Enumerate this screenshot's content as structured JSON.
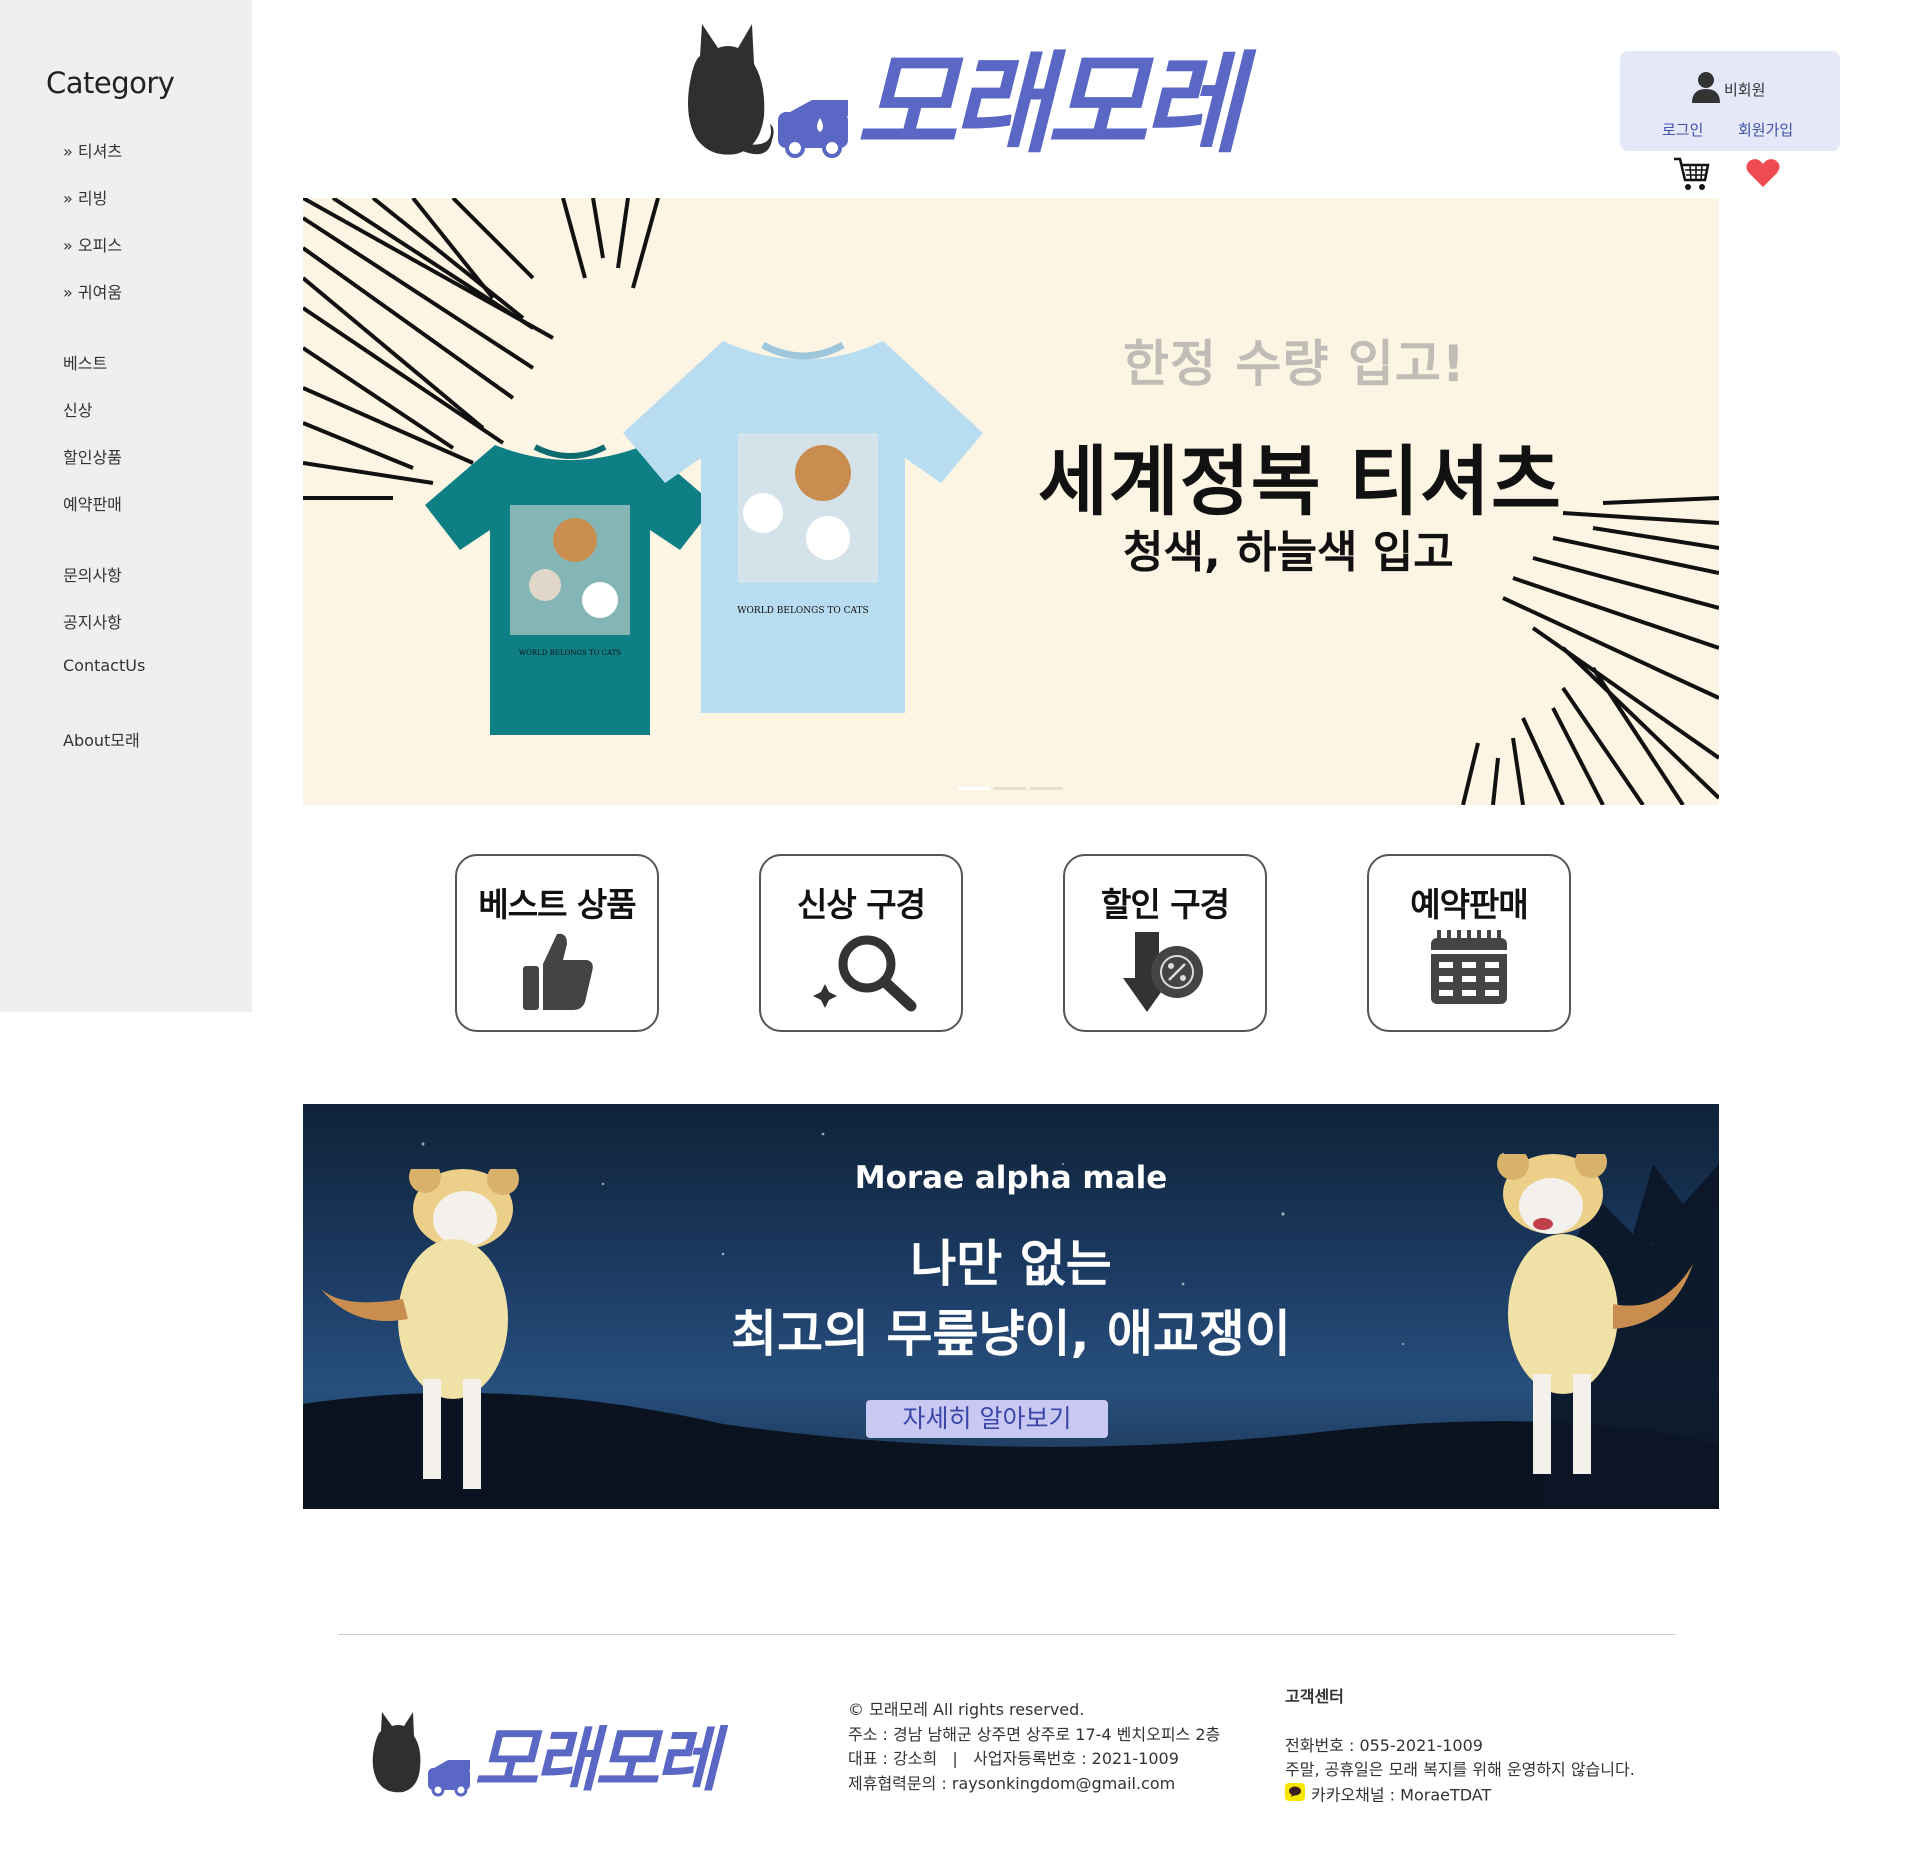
{
  "brand": {
    "name": "모래모레",
    "accent": "#5b67c4",
    "cat_color": "#2f2f2f"
  },
  "sidebar": {
    "title": "Category",
    "groups": [
      {
        "items": [
          {
            "label": "» 티셔츠"
          },
          {
            "label": "» 리빙"
          },
          {
            "label": "» 오피스"
          },
          {
            "label": "» 귀여움"
          }
        ]
      },
      {
        "items": [
          {
            "label": "베스트"
          },
          {
            "label": "신상"
          },
          {
            "label": "할인상품"
          },
          {
            "label": "예약판매"
          }
        ]
      },
      {
        "items": [
          {
            "label": "문의사항"
          },
          {
            "label": "공지사항"
          },
          {
            "label": "ContactUs"
          }
        ]
      },
      {
        "items": [
          {
            "label": "About모래"
          }
        ]
      }
    ]
  },
  "user": {
    "status": "비회원",
    "login": "로그인",
    "signup": "회원가입",
    "icons": [
      "user-icon",
      "cart-icon",
      "heart-icon"
    ]
  },
  "hero": {
    "sub": "한정 수량 입고!",
    "title": "세계정복 티셔츠",
    "desc": "청색, 하늘색 입고",
    "shirt_print": "WORLD BELONGS TO CATS",
    "shirt_colors": [
      "#0f7f86",
      "#b8dcf0"
    ],
    "background": "#fdf5e3"
  },
  "quick_links": [
    {
      "label": "베스트 상품",
      "icon": "thumbs-up-icon"
    },
    {
      "label": "신상 구경",
      "icon": "magnifier-icon"
    },
    {
      "label": "할인 구경",
      "icon": "discount-arrow-icon"
    },
    {
      "label": "예약판매",
      "icon": "calendar-icon"
    }
  ],
  "banner2": {
    "eyebrow": "Morae alpha male",
    "line1": "나만 없는",
    "line2": "최고의 무릎냥이, 애교쟁이",
    "button": "자세히 알아보기"
  },
  "footer": {
    "copyright": "© 모래모레 All rights reserved.",
    "address": "주소 : 경남 남해군 상주면 상주로 17-4 벤치오피스 2층",
    "ceo": "대표 : 강소희   |   사업자등록번호 : 2021-1009",
    "partner": "제휴협력문의 : raysonkingdom@gmail.com",
    "cs_title": "고객센터",
    "phone": "전화번호 : 055-2021-1009",
    "hours": "주말, 공휴일은 모래 복지를 위해 운영하지 않습니다.",
    "kakao": "카카오채널 : MoraeTDAT"
  }
}
